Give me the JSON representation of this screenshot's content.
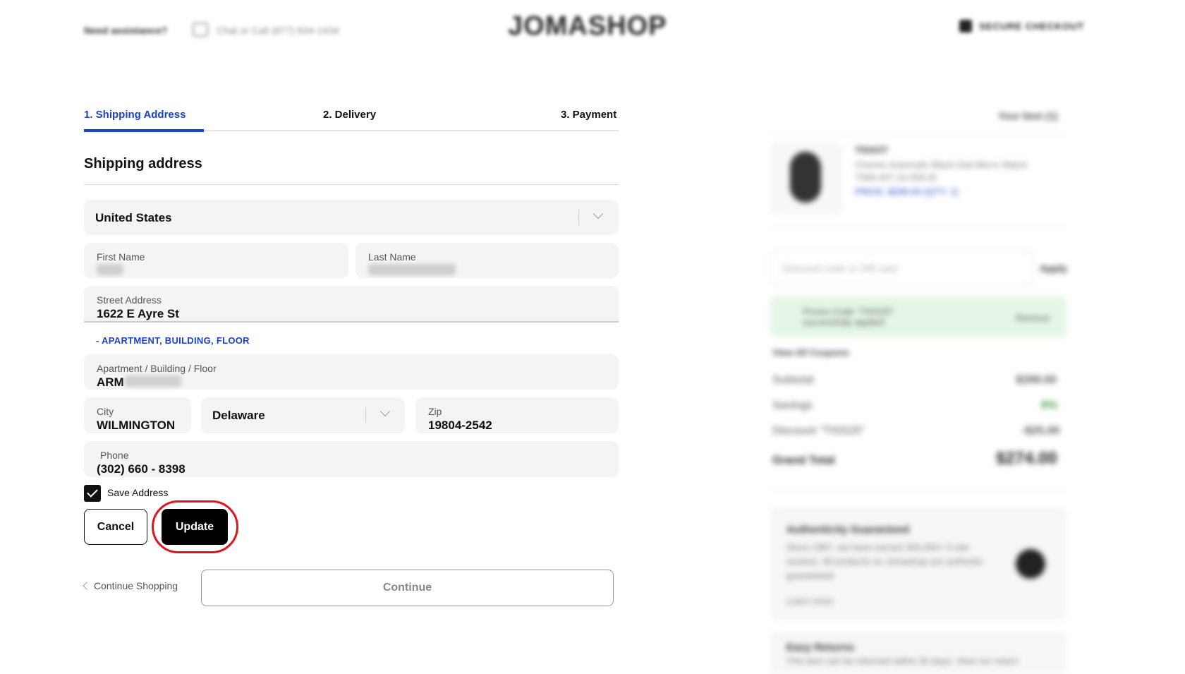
{
  "header": {
    "assistance": "Need assistance?",
    "chat": "Chat or Call (877) 834-1434",
    "logo": "JOMASHOP",
    "secure": "SECURE CHECKOUT"
  },
  "steps": [
    {
      "label": "1. Shipping Address",
      "active": true
    },
    {
      "label": "2. Delivery",
      "active": false
    },
    {
      "label": "3. Payment",
      "active": false
    }
  ],
  "form": {
    "title": "Shipping address",
    "country": "United States",
    "first_name_label": "First Name",
    "last_name_label": "Last Name",
    "street_label": "Street Address",
    "street_value": "1622 E Ayre St",
    "apt_toggle": "-  APARTMENT, BUILDING, FLOOR",
    "apt_label": "Apartment / Building / Floor",
    "apt_value": "ARM",
    "city_label": "City",
    "city_value": "WILMINGTON",
    "state_value": "Delaware",
    "zip_label": "Zip",
    "zip_value": "19804-2542",
    "phone_label": "Phone",
    "phone_value": "(302) 660 - 8398",
    "save_address_label": "Save Address",
    "save_address_checked": true
  },
  "actions": {
    "cancel": "Cancel",
    "update": "Update",
    "continue_shopping": "Continue Shopping",
    "continue": "Continue"
  },
  "summary": {
    "items_label": "Your Item (1)",
    "product_brand": "TISSOT",
    "product_name": "Chemin Automatic Black Dial Men's Watch",
    "product_sku": "T099.407.16.058.00",
    "product_price": "PRICE: $299.00 (QTY: 1)",
    "discount_placeholder": "Discount code or Gift card",
    "apply": "Apply",
    "promo_text": "Promo Code \"TISS25\" successfully applied",
    "promo_remove": "Remove",
    "view_coupons": "View All Coupons",
    "subtotal_label": "Subtotal",
    "subtotal_value": "$299.00",
    "savings_label": "Savings",
    "savings_value": "8%",
    "discount_label": "Discount \"TISS25\"",
    "discount_value": "-$25.00",
    "grand_total_label": "Grand Total",
    "grand_total_value": "$274.00",
    "auth_title": "Authenticity Guaranteed",
    "auth_text": "Since 1987, we have earned 300,000+ 5 star reviews. All products on Jomashop are authentic guaranteed.",
    "auth_link": "Learn more",
    "returns_title": "Easy Returns",
    "returns_text": "This item can be returned within 30 days. View our return"
  },
  "colors": {
    "accent": "#1a44c8",
    "highlight": "#e0141e",
    "promo_bg": "#e6f6e6"
  }
}
